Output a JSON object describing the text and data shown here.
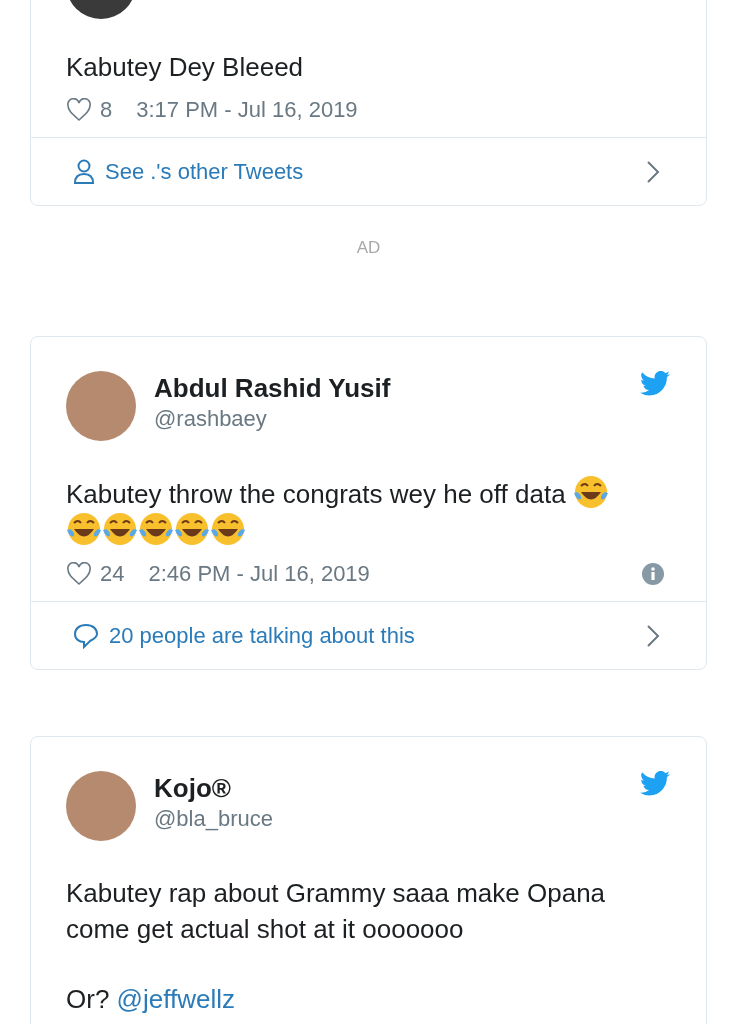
{
  "tweets": [
    {
      "paragraphs": [
        [
          {
            "kind": "text",
            "text": "Kabutey Dey Bleeed"
          }
        ]
      ],
      "likes": "8",
      "time": "3:17 PM - Jul 16, 2019",
      "footer": {
        "kind": "profile",
        "label": "See .'s other Tweets"
      }
    },
    {
      "name": "Abdul Rashid Yusif",
      "handle": "@rashbaey",
      "logo": true,
      "paragraphs": [
        [
          {
            "kind": "text",
            "text": "Kabutey throw the congrats wey he off data "
          },
          {
            "kind": "emoji"
          },
          {
            "kind": "emoji"
          },
          {
            "kind": "emoji"
          },
          {
            "kind": "emoji"
          },
          {
            "kind": "emoji"
          },
          {
            "kind": "emoji"
          }
        ]
      ],
      "likes": "24",
      "time": "2:46 PM - Jul 16, 2019",
      "info": true,
      "footer": {
        "kind": "replies",
        "label": "20 people are talking about this"
      }
    },
    {
      "name": "Kojo®",
      "handle": "@bla_bruce",
      "logo": true,
      "paragraphs": [
        [
          {
            "kind": "text",
            "text": "Kabutey rap about Grammy saaa make Opana come get actual shot at it ooooooo"
          }
        ],
        [
          {
            "kind": "text",
            "text": "Or? "
          },
          {
            "kind": "mention",
            "text": "@jeffwellz"
          }
        ]
      ]
    }
  ],
  "ad_label": "AD"
}
